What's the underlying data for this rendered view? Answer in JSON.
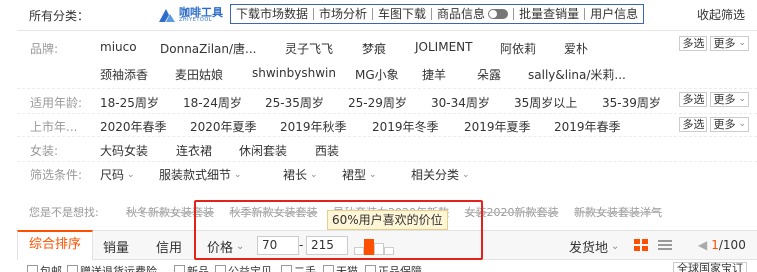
{
  "topbar": {
    "all_categories": "所有分类：",
    "logo_text": "咖啡工具",
    "logo_sub": "ZHIYETOOL",
    "tools": [
      "下载市场数据",
      "市场分析",
      "车图下载",
      "商品信息",
      "批量查销量",
      "用户信息"
    ],
    "collapse": "收起筛选"
  },
  "filters": {
    "brand_label": "品牌:",
    "brands_row1": [
      "miuco",
      "DonnaZilan/唐...",
      "灵子飞飞",
      "梦痕",
      "JOLIMENT",
      "阿依莉",
      "爱朴"
    ],
    "brands_row2": [
      "颈袖添香",
      "麦田姑娘",
      "shwinbyshwin",
      "MG小象",
      "捷羊",
      "朵露",
      "sally&lina/米莉..."
    ],
    "age_label": "适用年龄:",
    "ages": [
      "18-25周岁",
      "18-24周岁",
      "25-35周岁",
      "25-29周岁",
      "30-34周岁",
      "35周岁以上",
      "35-39周岁"
    ],
    "season_label": "上市年...",
    "seasons": [
      "2020年春季",
      "2020年夏季",
      "2019年秋季",
      "2019年冬季",
      "2019年夏季",
      "2019年春季"
    ],
    "style_label": "女装:",
    "styles": [
      "大码女装",
      "连衣裙",
      "休闲套装",
      "西装"
    ],
    "cond_label": "筛选条件:",
    "conds": [
      "尺码",
      "服装款式细节",
      "裙长",
      "裙型",
      "相关分类"
    ],
    "multi": "多选",
    "more": "更多"
  },
  "guess": {
    "label": "您是不是想找:",
    "items": [
      "秋冬新款女装套装",
      "秋季新款女装套装",
      "早秋套装女2020年新款",
      "女装2020新款套装",
      "新款女装套装洋气"
    ]
  },
  "tooltip": "60%用户喜欢的价位",
  "sortbar": {
    "sort_first": "综合排序",
    "sales": "销量",
    "credit": "信用",
    "price": "价格",
    "price_min": "70",
    "price_max": "215",
    "dash": "-",
    "ship_from": "发货地",
    "page": "1",
    "page_total": "/100"
  },
  "bottom": {
    "checks": [
      "包邮",
      "赠送退货运费险",
      "新品",
      "公益宝贝",
      "二手",
      "天猫",
      "正品保障"
    ],
    "right": "全球国家宝订"
  }
}
